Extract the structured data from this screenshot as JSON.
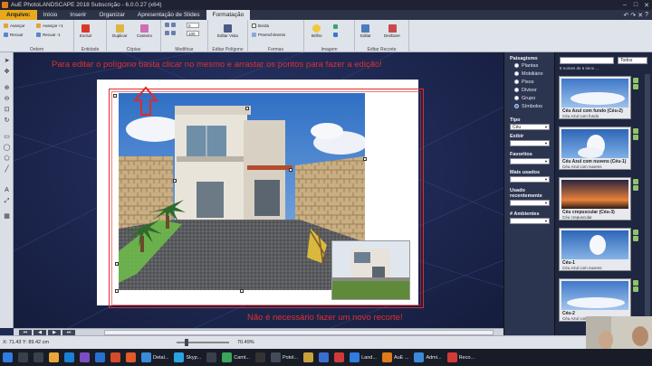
{
  "window": {
    "title": "AuE PhotoLANDSCAPE 2018 Subscrição - 6.0.0.27 (x64)",
    "controls": [
      "–",
      "□",
      "✕"
    ]
  },
  "menubar": {
    "tabs": [
      "Arquivo:",
      "Início",
      "Inserir",
      "Organizar",
      "Apresentação de Slides",
      "Formatação"
    ],
    "active": "Formatação",
    "right_controls": [
      "↶",
      "↷",
      "✕",
      "?"
    ]
  },
  "ribbon": {
    "groups": [
      "Ordem",
      "Entidade",
      "Cópias",
      "Modificar",
      "Editar Polígono",
      "Formas",
      "Imagem",
      "Editar Recorte"
    ],
    "buttons": {
      "avancar": "Avançar",
      "avancar_plus": "Avançar +1",
      "recuar": "Recuar",
      "recuar_minus": "Recuar -1",
      "excluir": "Excluir",
      "duplicar": "Duplicar",
      "canteiro": "Canteiro",
      "editar_vista": "Editar Vista",
      "borda": "Borda",
      "preenchimento": "Preenchimento",
      "brilho": "Brilho",
      "editar": "Editar",
      "desfazer": "Desfazer"
    },
    "rotate_value": "0",
    "scale_value": "100"
  },
  "canvas": {
    "hint_top": "Para editar o polígono basta clicar no mesmo e arrastar os pontos para fazer a edição!",
    "hint_bottom": "Não é necessário fazer um novo recorte!"
  },
  "status": {
    "coords": "X: 71.43  Y: 89.42 cm",
    "zoom": "70.49%"
  },
  "side_panel": {
    "section_title": "Paisagismo",
    "categories": [
      "Plantas",
      "Mobiliário",
      "Pisos",
      "Divisor",
      "Grupo",
      "Símbolos"
    ],
    "selected_category": "Símbolos",
    "filters": [
      {
        "label": "Tipo",
        "value": "Céu"
      },
      {
        "label": "Exibir",
        "value": ""
      },
      {
        "label": "Favoritos",
        "value": ""
      },
      {
        "label": "Mais usados",
        "value": ""
      },
      {
        "label": "Usado recentemente",
        "value": ""
      },
      {
        "label": "# Ambientes",
        "value": ""
      }
    ]
  },
  "gallery": {
    "filter": "Todos",
    "count_text": "8 nomes de 5 itens ...",
    "items": [
      {
        "title": "Céu Azul com fundo (Céu-2)",
        "subtitle": "Céu Azul com fundo"
      },
      {
        "title": "Céu Azul com nuvens (Céu-1)",
        "subtitle": "Céu Azul com nuvens"
      },
      {
        "title": "Céu crepuscular (Céu-3)",
        "subtitle": "Céu crepuscular"
      },
      {
        "title": "Céu-1",
        "subtitle": "Céu Azul com nuvens"
      },
      {
        "title": "Céu-2",
        "subtitle": "Céu Azul com fundo"
      }
    ]
  },
  "taskbar": {
    "apps": [
      {
        "label": "Detal...",
        "icon": "chrome-icon"
      },
      {
        "label": "Skyp...",
        "icon": "skype-icon"
      },
      {
        "label": "Camt...",
        "icon": "camtasia-icon"
      },
      {
        "label": "Potol...",
        "icon": "app-icon"
      },
      {
        "label": "Land...",
        "icon": "landscape-icon"
      },
      {
        "label": "AuE ...",
        "icon": "aue-icon"
      },
      {
        "label": "Admi...",
        "icon": "chrome-icon"
      },
      {
        "label": "Reco...",
        "icon": "recorder-icon"
      }
    ]
  }
}
